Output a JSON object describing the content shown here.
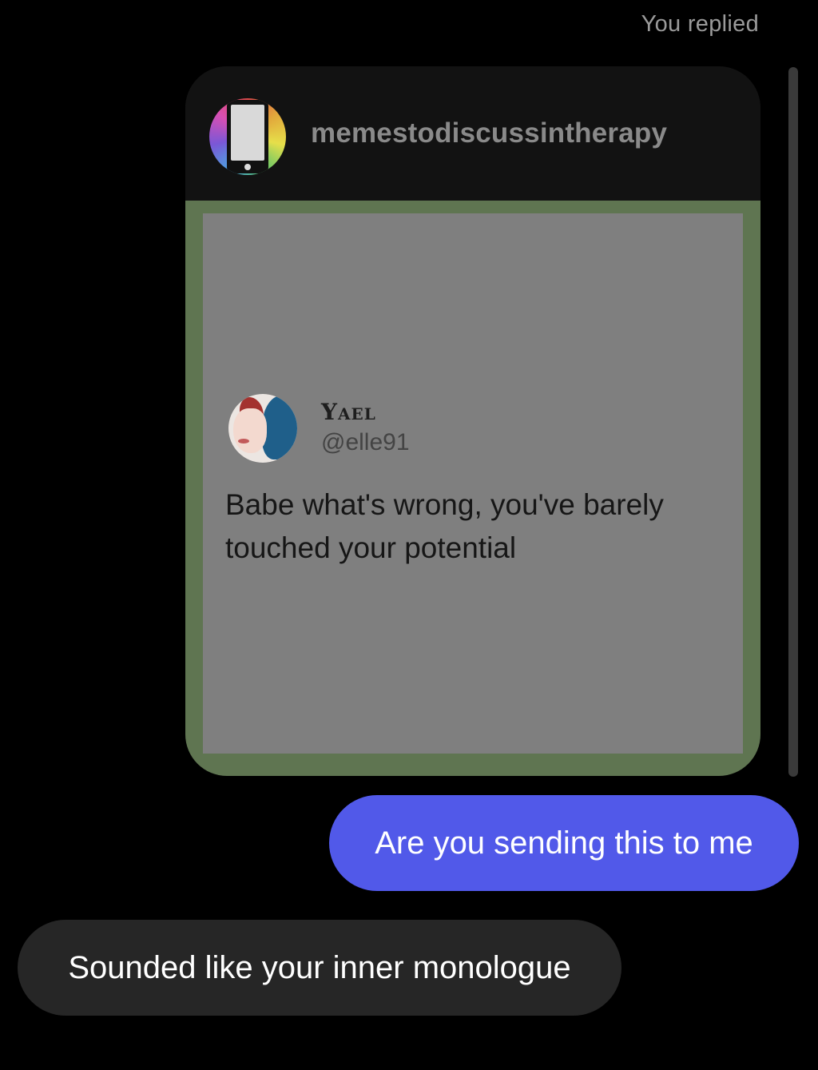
{
  "reply_label": "You replied",
  "shared_post": {
    "username": "memestodiscussintherapy",
    "avatar_icon": "phone-app-logo-icon",
    "tweet": {
      "name": "Yael",
      "handle": "@elle91",
      "text": "Babe what's wrong, you've barely touched your potential"
    }
  },
  "messages": [
    {
      "direction": "sent",
      "text": "Are you sending this to me"
    },
    {
      "direction": "received",
      "text": "Sounded like your inner monologue"
    }
  ],
  "colors": {
    "background": "#000000",
    "sent_bubble": "#5159e9",
    "received_bubble": "#262626",
    "post_frame": "#5f7551",
    "tweet_card": "#7f7f7f"
  }
}
